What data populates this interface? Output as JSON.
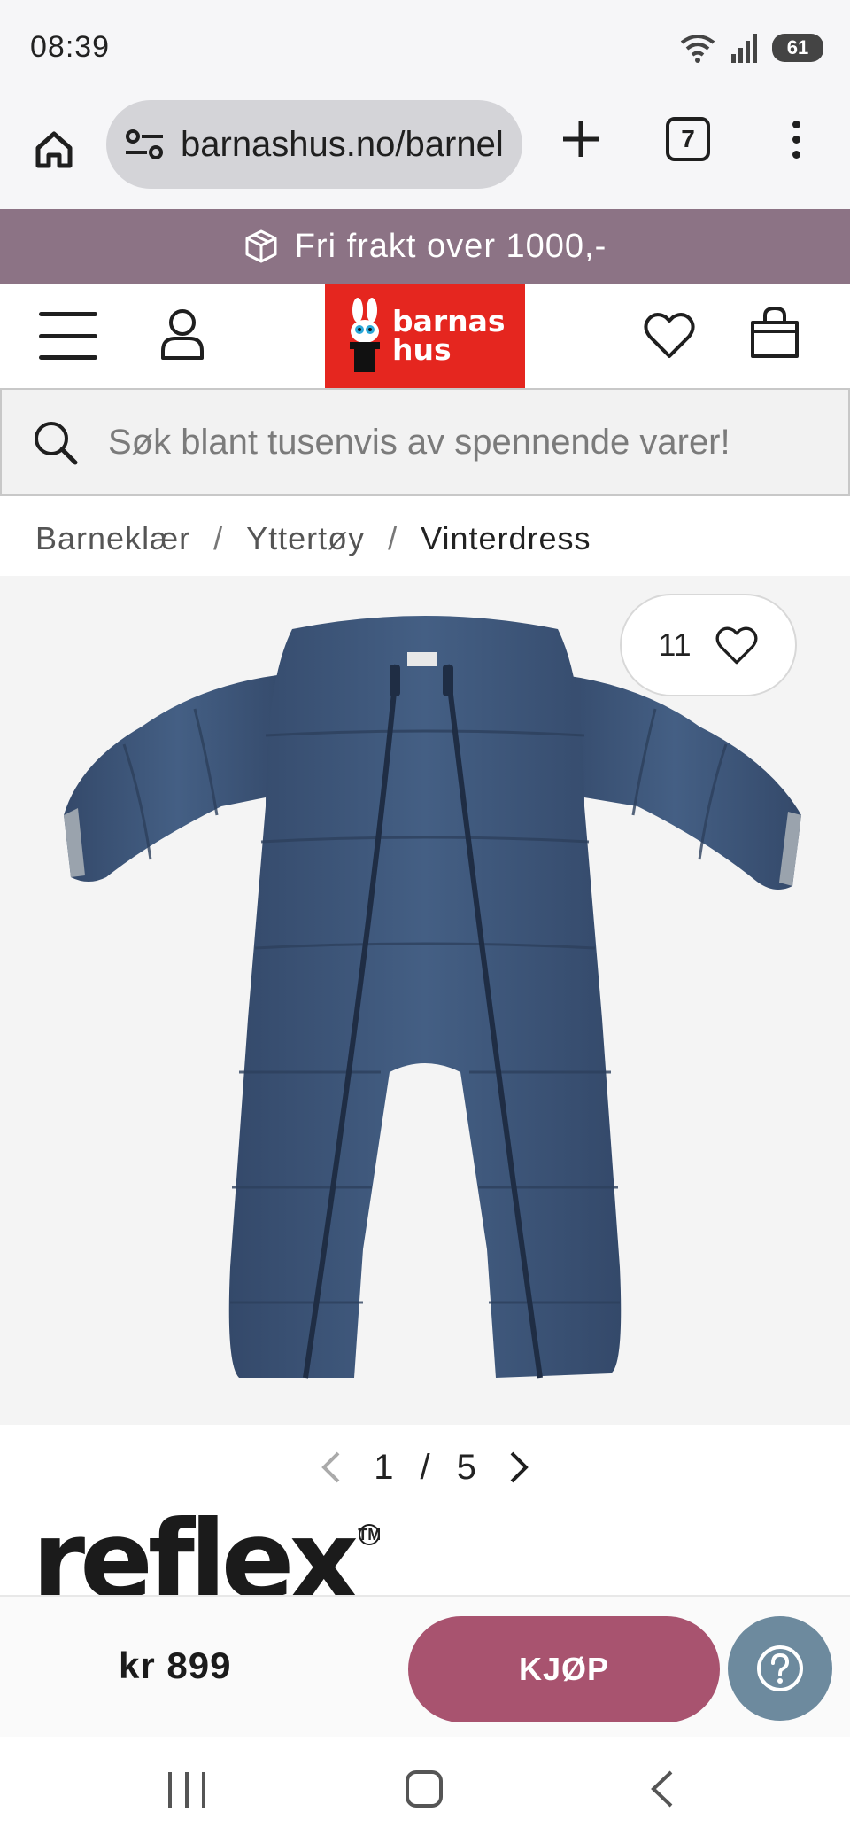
{
  "status_bar": {
    "time": "08:39",
    "battery": "61",
    "icons": [
      "wifi-icon",
      "signal-icon",
      "battery-icon"
    ]
  },
  "browser": {
    "url": "barnashus.no/barnel",
    "tab_count": "7",
    "icons": [
      "home-icon",
      "site-settings-icon",
      "plus-icon",
      "tabs-icon",
      "more-icon"
    ]
  },
  "promo": {
    "text": "Fri frakt over 1000,-",
    "icon": "package-icon",
    "color": "#8c7385"
  },
  "header": {
    "logo_line1": "barnas",
    "logo_line2": "hus",
    "logo_color": "#e5261f",
    "icons": [
      "menu-icon",
      "account-icon",
      "heart-icon",
      "bag-icon"
    ]
  },
  "search": {
    "placeholder": "Søk blant tusenvis av spennende varer!"
  },
  "breadcrumb": {
    "items": [
      "Barneklær",
      "Yttertøy",
      "Vinterdress"
    ],
    "separator": "/"
  },
  "product": {
    "favorites_count": "11",
    "image_index": "1",
    "image_total": "5",
    "brand": "reflex",
    "trademark": "TM",
    "suit_color": "#3d5675"
  },
  "buy_bar": {
    "price": "kr 899",
    "buy_label": "KJØP",
    "buy_color": "#a8536f",
    "help_color": "#6d8a9e"
  },
  "nav_bar": {
    "icons": [
      "recents-icon",
      "home-icon",
      "back-icon"
    ]
  }
}
